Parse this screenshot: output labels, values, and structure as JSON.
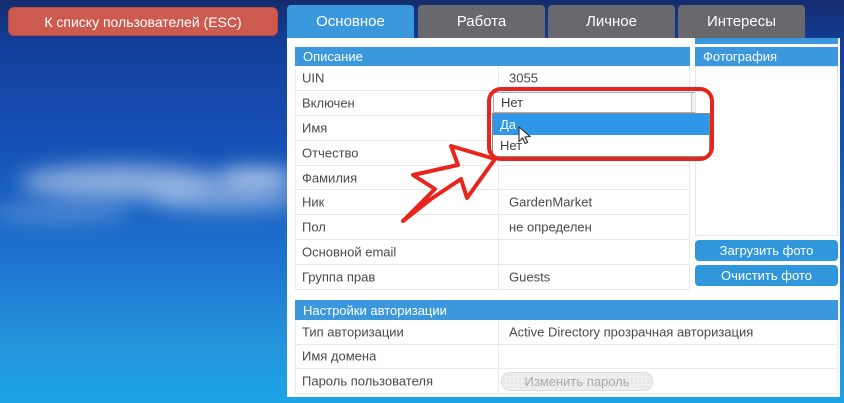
{
  "window": {
    "back_button": "К списку пользователей (ESC)"
  },
  "tabs": [
    {
      "label": "Основное",
      "active": true
    },
    {
      "label": "Работа",
      "active": false
    },
    {
      "label": "Личное",
      "active": false
    },
    {
      "label": "Интересы",
      "active": false
    }
  ],
  "description": {
    "title": "Описание",
    "rows": [
      {
        "label": "UIN",
        "value": "3055"
      },
      {
        "label": "Включен"
      },
      {
        "label": "Имя",
        "value": ""
      },
      {
        "label": "Отчество",
        "value": ""
      },
      {
        "label": "Фамилия",
        "value": ""
      },
      {
        "label": "Ник",
        "value": "GardenMarket"
      },
      {
        "label": "Пол",
        "value": "не определен"
      },
      {
        "label": "Основной email",
        "value": ""
      },
      {
        "label": "Группа прав",
        "value": "Guests"
      }
    ]
  },
  "enabled_dropdown": {
    "selected": "Нет",
    "options": [
      "Да",
      "Нет"
    ],
    "highlighted": "Да"
  },
  "photo": {
    "title": "Фотография",
    "upload_button": "Загрузить фото",
    "clear_button": "Очистить фото"
  },
  "auth": {
    "title": "Настройки авторизации",
    "rows": [
      {
        "label": "Тип авторизации",
        "value": "Active Directory прозрачная авторизация"
      },
      {
        "label": "Имя домена",
        "value": ""
      },
      {
        "label": "Пароль пользователя"
      }
    ],
    "change_password_button": "Изменить пароль"
  },
  "colors": {
    "accent_blue": "#3b98dd",
    "tab_inactive": "#69696d",
    "back_button_red": "#cd5a4f",
    "annotation_red": "#e8241c",
    "dropdown_highlight": "#2f97ea"
  }
}
